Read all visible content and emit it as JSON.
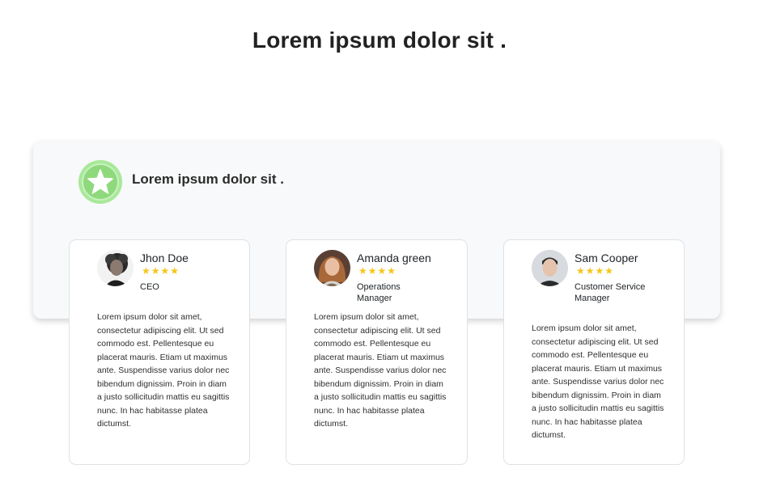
{
  "header": {
    "title": "Lorem ipsum dolor sit ."
  },
  "panel": {
    "title": "Lorem ipsum dolor sit ."
  },
  "testimonials": [
    {
      "name": "Jhon Doe",
      "stars": "★★★★",
      "rating": 4,
      "role": "CEO",
      "quote": "Lorem ipsum dolor sit amet, consectetur adipiscing elit. Ut sed commodo est. Pellentesque eu placerat mauris. Etiam ut maximus ante. Suspendisse varius dolor nec bibendum dignissim. Proin in diam a justo sollicitudin mattis eu sagittis nunc. In hac habitasse platea dictumst."
    },
    {
      "name": "Amanda green",
      "stars": "★★★★",
      "rating": 4,
      "role": "Operations Manager",
      "quote": "Lorem ipsum dolor sit amet, consectetur adipiscing elit. Ut sed commodo est. Pellentesque eu placerat mauris. Etiam ut maximus ante. Suspendisse varius dolor nec bibendum dignissim. Proin in diam a justo sollicitudin mattis eu sagittis nunc. In hac habitasse platea dictumst."
    },
    {
      "name": "Sam Cooper",
      "stars": "★★★★",
      "rating": 4,
      "role": "Customer Service Manager",
      "quote": "Lorem ipsum dolor sit amet, consectetur adipiscing elit. Ut sed commodo est. Pellentesque eu placerat mauris. Etiam ut maximus ante. Suspendisse varius dolor nec bibendum dignissim. Proin in diam a justo sollicitudin mattis eu sagittis nunc. In hac habitasse platea dictumst."
    }
  ],
  "colors": {
    "star": "#f5c518",
    "badge": "#8fd97d",
    "panel_bg": "#f8f9fa"
  },
  "icons": {
    "badge": "star-badge-icon"
  }
}
